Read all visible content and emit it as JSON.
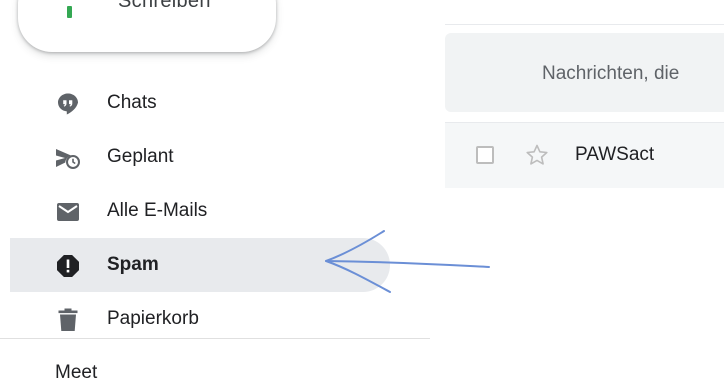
{
  "compose": {
    "label": "Schreiben",
    "icon": "plus-icon",
    "accent": "#34a853"
  },
  "sidebar": {
    "items": [
      {
        "label": "Chats",
        "icon": "chat-icon",
        "active": false
      },
      {
        "label": "Geplant",
        "icon": "scheduled-send-icon",
        "active": false
      },
      {
        "label": "Alle E-Mails",
        "icon": "mail-icon",
        "active": false
      },
      {
        "label": "Spam",
        "icon": "spam-icon",
        "active": true
      },
      {
        "label": "Papierkorb",
        "icon": "trash-icon",
        "active": false
      }
    ],
    "section_title": "Meet"
  },
  "main": {
    "info_text": "Nachrichten, die",
    "rows": [
      {
        "sender": "PAWSact",
        "starred": false,
        "selected": false
      }
    ]
  },
  "annotation": {
    "type": "hand-drawn-arrow",
    "color": "#6b8fd6"
  },
  "colors": {
    "active_bg": "#e8eaed",
    "icon": "#5f6368",
    "info_bg": "#f1f3f4"
  }
}
